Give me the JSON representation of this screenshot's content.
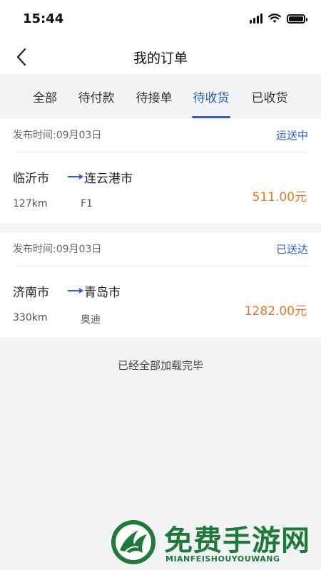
{
  "status_bar": {
    "time": "15:44"
  },
  "nav": {
    "title": "我的订单"
  },
  "tabs": [
    {
      "label": "全部",
      "active": false
    },
    {
      "label": "待付款",
      "active": false
    },
    {
      "label": "待接单",
      "active": false
    },
    {
      "label": "待收货",
      "active": true
    },
    {
      "label": "已收货",
      "active": false
    }
  ],
  "orders": [
    {
      "publish_time": "发布时间:09月03日",
      "status": "运送中",
      "from_city": "临沂市",
      "to_city": "连云港市",
      "distance": "127km",
      "vehicle": "F1",
      "price": "511.00元"
    },
    {
      "publish_time": "发布时间:09月03日",
      "status": "已送达",
      "from_city": "济南市",
      "to_city": "青岛市",
      "distance": "330km",
      "vehicle": "奥迪",
      "price": "1282.00元"
    }
  ],
  "list_end_text": "已经全部加载完毕",
  "watermark": {
    "title": "免费手游网",
    "subtitle": "MIANFEISHOUYOUWANG"
  },
  "colors": {
    "accent": "#2a5fd0",
    "price": "#e0782a",
    "background": "#f2f3f5",
    "watermark": "#1f7a3a"
  }
}
